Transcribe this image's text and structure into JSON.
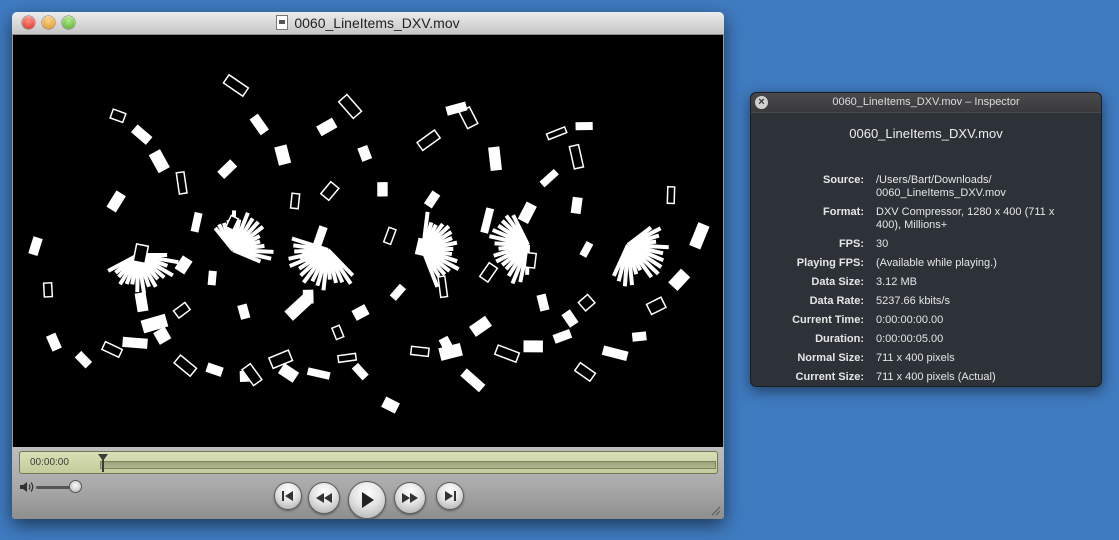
{
  "player": {
    "title": "0060_LineItems_DXV.mov",
    "timecode": "00:00:00",
    "progress": 0.0,
    "volume": 0.8,
    "buttons": {
      "go_to_start": "skip-to-start-icon",
      "rewind": "rewind-icon",
      "play": "play-icon",
      "fast_forward": "fast-forward-icon",
      "go_to_end": "skip-to-end-icon"
    }
  },
  "inspector": {
    "window_title": "0060_LineItems_DXV.mov – Inspector",
    "filename": "0060_LineItems_DXV.mov",
    "rows": [
      {
        "label": "Source:",
        "value": "/Users/Bart/Downloads/ 0060_LineItems_DXV.mov"
      },
      {
        "label": "Format:",
        "value": "DXV Compressor, 1280 x 400 (711 x 400), Millions+"
      },
      {
        "label": "FPS:",
        "value": "30"
      },
      {
        "label": "Playing FPS:",
        "value": "(Available while playing.)"
      },
      {
        "label": "Data Size:",
        "value": "3.12 MB"
      },
      {
        "label": "Data Rate:",
        "value": "5237.66 kbits/s"
      },
      {
        "label": "Current Time:",
        "value": "0:00:00:00.00"
      },
      {
        "label": "Duration:",
        "value": "0:00:00:05.00"
      },
      {
        "label": "Normal Size:",
        "value": "711 x 400 pixels"
      },
      {
        "label": "Current Size:",
        "value": "711 x 400 pixels (Actual)"
      }
    ]
  },
  "colors": {
    "desktop": "#3f7bc0",
    "inspector_bg": "#2c2c2e",
    "lcd": "#d0d6ab"
  }
}
